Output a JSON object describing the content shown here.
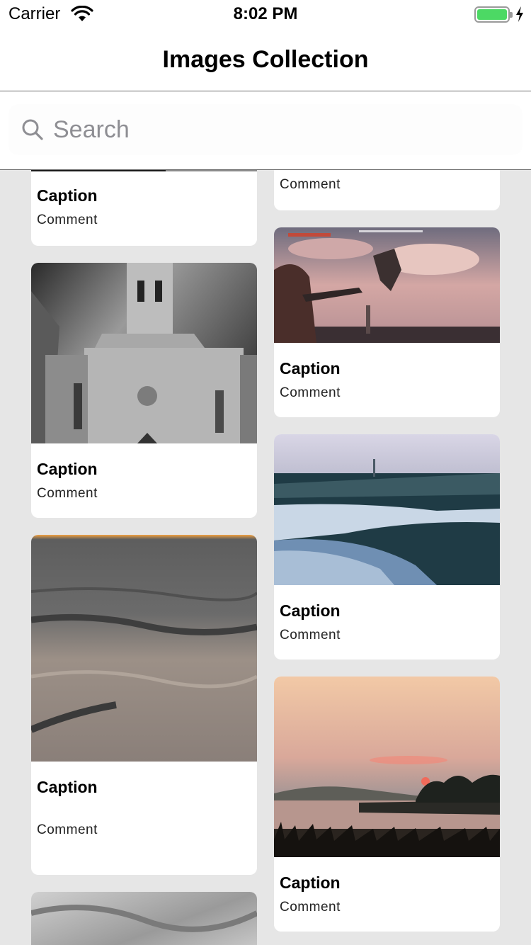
{
  "status_bar": {
    "carrier": "Carrier",
    "time": "8:02 PM",
    "battery_color": "#4cd964"
  },
  "nav": {
    "title": "Images Collection"
  },
  "search": {
    "placeholder": "Search",
    "icon": "magnifying-glass"
  },
  "cards": [
    {
      "caption": "Caption",
      "comment": "Comment",
      "image": "partial-top"
    },
    {
      "caption": "Caption",
      "comment": "Comment",
      "image": "church-bw"
    },
    {
      "caption": "Caption",
      "comment": "Comment",
      "image": "sea-waves"
    },
    {
      "caption": "",
      "comment": "Comment",
      "image": "partial-top"
    },
    {
      "caption": "Caption",
      "comment": "Comment",
      "image": "game-scene"
    },
    {
      "caption": "Caption",
      "comment": "Comment",
      "image": "snowy-landscape"
    },
    {
      "caption": "Caption",
      "comment": "Comment",
      "image": "sunset-lake"
    },
    {
      "caption": "",
      "comment": "",
      "image": "clouds-bw"
    }
  ]
}
